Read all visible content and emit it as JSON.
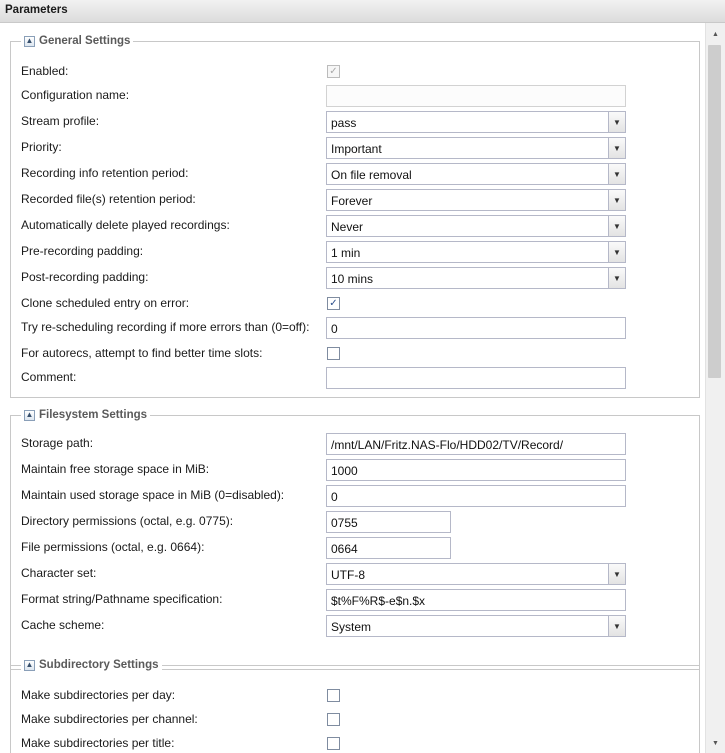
{
  "window": {
    "title": "Parameters"
  },
  "sections": {
    "general": {
      "title": "General Settings",
      "toggle_icon": "collapse-up-icon",
      "enabled_label": "Enabled:",
      "config_name_label": "Configuration name:",
      "config_name_value": "",
      "stream_profile_label": "Stream profile:",
      "stream_profile_value": "pass",
      "priority_label": "Priority:",
      "priority_value": "Important",
      "info_retention_label": "Recording info retention period:",
      "info_retention_value": "On file removal",
      "file_retention_label": "Recorded file(s) retention period:",
      "file_retention_value": "Forever",
      "auto_delete_label": "Automatically delete played recordings:",
      "auto_delete_value": "Never",
      "pre_padding_label": "Pre-recording padding:",
      "pre_padding_value": "1 min",
      "post_padding_label": "Post-recording padding:",
      "post_padding_value": "10 mins",
      "clone_label": "Clone scheduled entry on error:",
      "reschedule_label": "Try re-scheduling recording if more errors than (0=off):",
      "reschedule_value": "0",
      "autorec_label": "For autorecs, attempt to find better time slots:",
      "comment_label": "Comment:",
      "comment_value": ""
    },
    "filesystem": {
      "title": "Filesystem Settings",
      "toggle_icon": "collapse-up-icon",
      "storage_path_label": "Storage path:",
      "storage_path_value": "/mnt/LAN/Fritz.NAS-Flo/HDD02/TV/Record/",
      "free_space_label": "Maintain free storage space in MiB:",
      "free_space_value": "1000",
      "used_space_label": "Maintain used storage space in MiB (0=disabled):",
      "used_space_value": "0",
      "dir_perm_label": "Directory permissions (octal, e.g. 0775):",
      "dir_perm_value": "0755",
      "file_perm_label": "File permissions (octal, e.g. 0664):",
      "file_perm_value": "0664",
      "charset_label": "Character set:",
      "charset_value": "UTF-8",
      "format_label": "Format string/Pathname specification:",
      "format_value": "$t%F%R$-e$n.$x",
      "cache_label": "Cache scheme:",
      "cache_value": "System"
    },
    "subdirectory": {
      "title": "Subdirectory Settings",
      "toggle_icon": "collapse-up-icon",
      "per_day_label": "Make subdirectories per day:",
      "per_channel_label": "Make subdirectories per channel:",
      "per_title_label": "Make subdirectories per title:"
    }
  },
  "checkboxes": {
    "enabled": true,
    "enabled_disabled_state": true,
    "clone_on_error": true,
    "autorec_better_slots": false,
    "subdir_per_day": false,
    "subdir_per_channel": false,
    "subdir_per_title": false
  },
  "glyphs": {
    "check": "✓",
    "dropdown": "▼",
    "collapse": "▲",
    "scroll_up": "▲",
    "scroll_down": "▼"
  }
}
